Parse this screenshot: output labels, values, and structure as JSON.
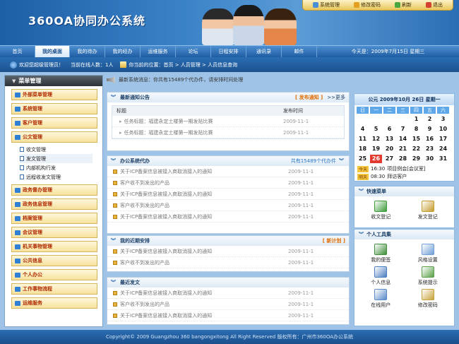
{
  "app": {
    "title": "360OA协同办公系统"
  },
  "toolbar": {
    "items": [
      {
        "label": "系统管理",
        "icon": "gear-icon",
        "color": "#4a8fd6"
      },
      {
        "label": "修改密码",
        "icon": "key-icon",
        "color": "#e3a020"
      },
      {
        "label": "刷新",
        "icon": "refresh-icon",
        "color": "#4aa640"
      },
      {
        "label": "退出",
        "icon": "exit-icon",
        "color": "#d4412e"
      }
    ]
  },
  "nav": {
    "items": [
      "首页",
      "我的桌面",
      "我的待办",
      "我的经办",
      "运维服务",
      "论坛",
      "日程安排",
      "通讯录",
      "邮件"
    ],
    "active": 1,
    "date": "今天是：2009年7月15日  星期三"
  },
  "subbar": {
    "welcome": "欢迎您超级管理员！",
    "online": "当前在线人数：1人",
    "location": "你当前的位置：首页  >  人员管理  >  人员信息查询"
  },
  "sidebar": {
    "title": "菜单管理",
    "groups_top": [
      "外部菜单管理",
      "系统管理",
      "客户管理",
      "公文管理"
    ],
    "sub_items": [
      "收文管理",
      "发文管理",
      "内部机构行发",
      "远程收发文管理"
    ],
    "sub_current": 1,
    "groups_bottom": [
      "政务督办管理",
      "政务信息管理",
      "档案管理",
      "会议管理",
      "机关事物管理",
      "公共信息",
      "个人办公",
      "工作事物流程",
      "运维服务"
    ]
  },
  "sysmsg": "最新系统消息：你共有15489个代办件，请安排时间处理",
  "notice": {
    "title": "最新通知公告",
    "tag": "[ 发布通知 ]",
    "more": ">>更多",
    "col_title": "标题",
    "col_time": "发布时间",
    "rows": [
      {
        "text": "任务标题：福建永定土楼第一期发贴比赛",
        "date": "2009-11-1"
      },
      {
        "text": "任务标题：福建永定土楼第一期发贴比赛",
        "date": "2009-11-1"
      }
    ]
  },
  "todo": {
    "title": "办公系统代办",
    "count": "共有15489个代办件",
    "rows": [
      {
        "text": "关于ICP备案信息被接入商取消接入的通知",
        "date": "2009-11-1"
      },
      {
        "text": "客户收不到发出的产品",
        "date": "2009-11-1"
      },
      {
        "text": "关于ICP备案信息被接入商取消接入的通知",
        "date": "2009-11-1"
      },
      {
        "text": "客户收不到发出的产品",
        "date": "2009-11-1"
      },
      {
        "text": "关于ICP备案信息被接入商取消接入的通知",
        "date": "2009-11-1"
      }
    ]
  },
  "plan": {
    "title": "我的近期安排",
    "tag": "[ 新计划 ]",
    "rows": [
      {
        "text": "关于ICP备案信息被接入商取消接入的通知",
        "date": "2009-11-1"
      },
      {
        "text": "客户收不到发出的产品",
        "date": "2009-11-1"
      }
    ]
  },
  "docs": {
    "title": "最近发文",
    "rows": [
      {
        "text": "关于ICP备案信息被接入商取消接入的通知",
        "date": "2009-11-1"
      },
      {
        "text": "客户收不到发出的产品",
        "date": "2009-11-1"
      },
      {
        "text": "关于ICP备案信息被接入商取消接入的通知",
        "date": "2009-11-1"
      }
    ]
  },
  "calendar": {
    "header": "公元  2009年10月  26日  星期一",
    "weekdays": [
      "日",
      "一",
      "二",
      "三",
      "四",
      "五",
      "六"
    ],
    "days": [
      "",
      "",
      "",
      "",
      "1",
      "2",
      "3",
      "4",
      "5",
      "6",
      "7",
      "8",
      "9",
      "10",
      "11",
      "12",
      "13",
      "14",
      "15",
      "16",
      "17",
      "18",
      "19",
      "20",
      "21",
      "22",
      "23",
      "24",
      "25",
      "26",
      "27",
      "28",
      "29",
      "30",
      "31"
    ],
    "today": "26",
    "events": [
      {
        "label": "今天",
        "time": "16:30",
        "text": "项目例会[会议室]"
      },
      {
        "label": "明天",
        "time": "08:30",
        "text": "拜访客户"
      }
    ]
  },
  "quick": {
    "title": "快速菜单",
    "items": [
      {
        "label": "收文登记",
        "icon": "inbox-doc-icon",
        "color": "#3f9c3a"
      },
      {
        "label": "发文登记",
        "icon": "pen-doc-icon",
        "color": "#c49b2d"
      }
    ]
  },
  "tools": {
    "title": "个人工具集",
    "items": [
      {
        "label": "我的便签",
        "icon": "house-note-icon",
        "color": "#3f8f3a"
      },
      {
        "label": "风格设置",
        "icon": "palette-icon",
        "color": "#6f9fd6"
      },
      {
        "label": "个人信息",
        "icon": "profile-card-icon",
        "color": "#4c7fc2"
      },
      {
        "label": "系统提示",
        "icon": "message-window-icon",
        "color": "#5aa04a"
      },
      {
        "label": "在线用户",
        "icon": "user-icon",
        "color": "#5b8bc9"
      },
      {
        "label": "修改密码",
        "icon": "key-window-icon",
        "color": "#c8a23c"
      }
    ]
  },
  "footer": "Copyright© 2009 Guangzhou 360 bangongxitong All Right Reserved    版权所有：广州市360OA办公系统"
}
